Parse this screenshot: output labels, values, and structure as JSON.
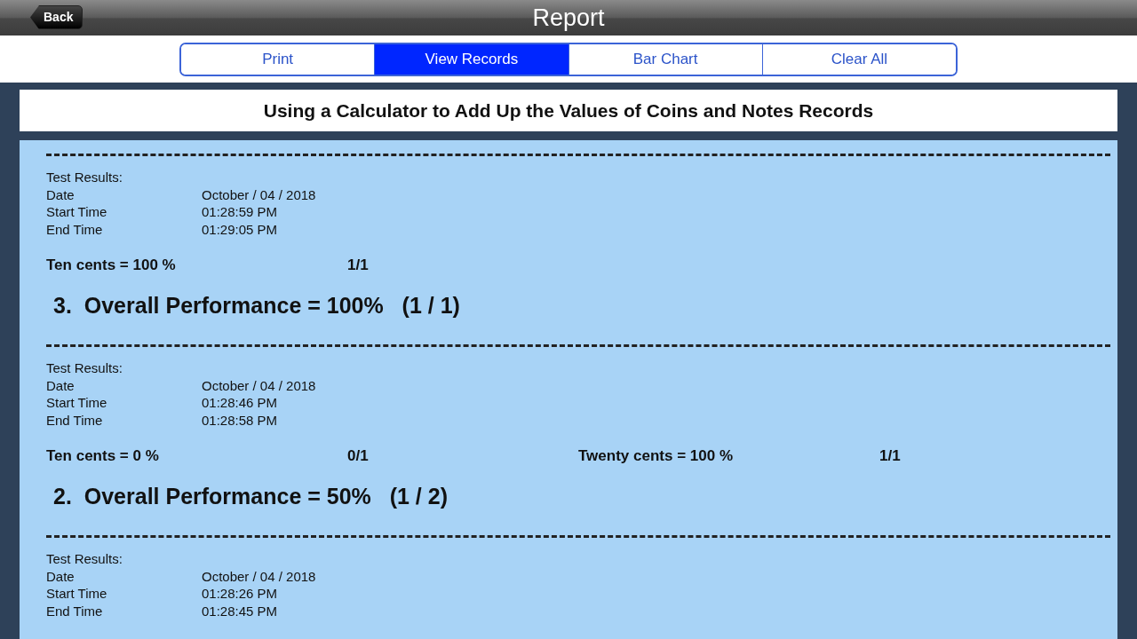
{
  "window": {
    "title": "Report",
    "back": "Back"
  },
  "tabs": [
    {
      "label": "Print",
      "selected": false
    },
    {
      "label": "View Records",
      "selected": true
    },
    {
      "label": "Bar Chart",
      "selected": false
    },
    {
      "label": "Clear All",
      "selected": false
    }
  ],
  "heading": "Using a Calculator to Add Up the Values of Coins and Notes Records",
  "records": [
    {
      "label": "Test Results:",
      "fields": [
        {
          "label": "Date",
          "value": "October / 04 / 2018"
        },
        {
          "label": "Start Time",
          "value": "01:28:59 PM"
        },
        {
          "label": "End Time",
          "value": "01:29:05 PM"
        }
      ],
      "scores": [
        {
          "label": "Ten cents = 100 %",
          "fraction": "1/1"
        }
      ],
      "overall": "3.  Overall Performance = 100%   (1 / 1)"
    },
    {
      "label": "Test Results:",
      "fields": [
        {
          "label": "Date",
          "value": "October / 04 / 2018"
        },
        {
          "label": "Start Time",
          "value": "01:28:46 PM"
        },
        {
          "label": "End Time",
          "value": "01:28:58 PM"
        }
      ],
      "scores": [
        {
          "label": "Ten cents = 0 %",
          "fraction": "0/1"
        },
        {
          "label": "Twenty cents = 100 %",
          "fraction": "1/1"
        }
      ],
      "overall": "2.  Overall Performance = 50%   (1 / 2)"
    },
    {
      "label": "Test Results:",
      "fields": [
        {
          "label": "Date",
          "value": "October / 04 / 2018"
        },
        {
          "label": "Start Time",
          "value": "01:28:26 PM"
        },
        {
          "label": "End Time",
          "value": "01:28:45 PM"
        }
      ]
    }
  ]
}
